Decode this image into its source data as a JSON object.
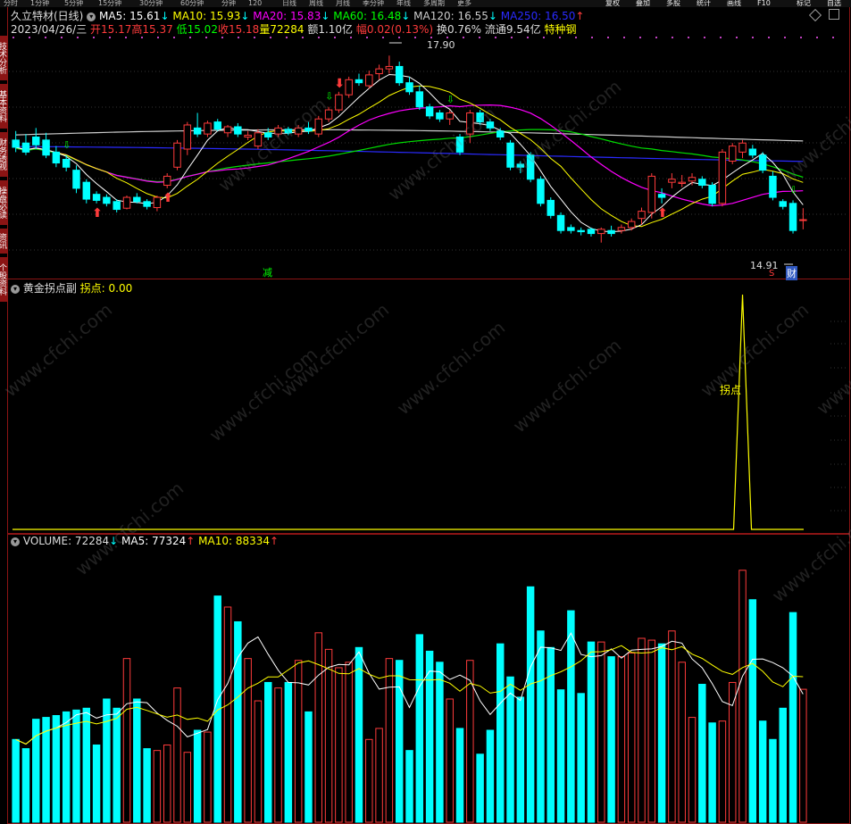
{
  "top_tabs": [
    "分时",
    "1分钟",
    "5分钟",
    "15分钟",
    "30分钟",
    "60分钟",
    "分钟",
    "120",
    "日线",
    "周线",
    "月线",
    "季分钟",
    "年线",
    "多周期",
    "更多"
  ],
  "top_buttons": [
    "复权",
    "叠加",
    "多股",
    "统计",
    "画线",
    "F10",
    "标记",
    "自选"
  ],
  "side_tabs": [
    "技术分析",
    "基本资料",
    "财务透视",
    "操盘必读",
    "资讯",
    "个股资料"
  ],
  "colors": {
    "up": "#ff3b3b",
    "down": "#00ffff",
    "ma5": "#ffffff",
    "ma10": "#ffff00",
    "ma20": "#ff00ff",
    "ma60": "#00ff00",
    "ma120": "#cccccc",
    "ma250": "#0000ff",
    "border": "#8b1414"
  },
  "header": {
    "title": "久立特材(日线)",
    "ma5_label": "MA5: 15.61",
    "ma10_label": "MA10: 15.93",
    "ma20_label": "MA20: 15.83",
    "ma60_label": "MA60: 16.48",
    "ma120_label": "MA120: 16.55",
    "ma250_label": "MA250: 16.50",
    "date": "2023/04/26/三",
    "open": "开15.17",
    "high": "高15.37",
    "low": "低15.02",
    "close": "收15.18",
    "vol": "量72284",
    "amount": "额1.10亿",
    "change": "幅0.02(0.13%)",
    "turnover": "换0.76%",
    "float": "流通9.54亿",
    "sector": "特种钢"
  },
  "price_annotations": {
    "high": "17.90",
    "low": "14.91",
    "reduce": "减",
    "s_mark": "S",
    "cai_mark": "财"
  },
  "indicator": {
    "name": "黄金拐点副",
    "value_label": "拐点: 0.00",
    "peak_label": "拐点"
  },
  "volume": {
    "name_label": "VOLUME: 72284",
    "ma5_label": "MA5: 77324",
    "ma10_label": "MA10: 88334"
  },
  "watermark": "www.cfchi.com",
  "chart_data": {
    "type": "candlestick",
    "price_ylim": [
      14.5,
      18.2
    ],
    "candles": [
      {
        "o": 16.5,
        "h": 16.65,
        "l": 16.3,
        "c": 16.38
      },
      {
        "o": 16.45,
        "h": 16.6,
        "l": 16.25,
        "c": 16.3
      },
      {
        "o": 16.55,
        "h": 16.7,
        "l": 16.35,
        "c": 16.42
      },
      {
        "o": 16.5,
        "h": 16.62,
        "l": 16.2,
        "c": 16.25
      },
      {
        "o": 16.3,
        "h": 16.4,
        "l": 16.05,
        "c": 16.12
      },
      {
        "o": 16.18,
        "h": 16.25,
        "l": 15.98,
        "c": 16.05
      },
      {
        "o": 16.0,
        "h": 16.08,
        "l": 15.62,
        "c": 15.7
      },
      {
        "o": 15.8,
        "h": 15.85,
        "l": 15.45,
        "c": 15.52
      },
      {
        "o": 15.6,
        "h": 15.65,
        "l": 15.45,
        "c": 15.5
      },
      {
        "o": 15.55,
        "h": 15.6,
        "l": 15.4,
        "c": 15.45
      },
      {
        "o": 15.48,
        "h": 15.52,
        "l": 15.3,
        "c": 15.35
      },
      {
        "o": 15.37,
        "h": 15.58,
        "l": 15.35,
        "c": 15.55
      },
      {
        "o": 15.55,
        "h": 15.62,
        "l": 15.45,
        "c": 15.48
      },
      {
        "o": 15.48,
        "h": 15.52,
        "l": 15.35,
        "c": 15.4
      },
      {
        "o": 15.38,
        "h": 15.58,
        "l": 15.32,
        "c": 15.55
      },
      {
        "o": 15.75,
        "h": 15.95,
        "l": 15.7,
        "c": 15.9
      },
      {
        "o": 16.05,
        "h": 16.5,
        "l": 16.0,
        "c": 16.45
      },
      {
        "o": 16.35,
        "h": 16.8,
        "l": 16.25,
        "c": 16.75
      },
      {
        "o": 16.7,
        "h": 16.95,
        "l": 16.55,
        "c": 16.6
      },
      {
        "o": 16.6,
        "h": 16.82,
        "l": 16.55,
        "c": 16.78
      },
      {
        "o": 16.8,
        "h": 16.85,
        "l": 16.65,
        "c": 16.68
      },
      {
        "o": 16.62,
        "h": 16.75,
        "l": 16.55,
        "c": 16.72
      },
      {
        "o": 16.72,
        "h": 16.78,
        "l": 16.55,
        "c": 16.6
      },
      {
        "o": 16.55,
        "h": 16.65,
        "l": 16.5,
        "c": 16.58
      },
      {
        "o": 16.4,
        "h": 16.68,
        "l": 16.35,
        "c": 16.62
      },
      {
        "o": 16.62,
        "h": 16.7,
        "l": 16.5,
        "c": 16.55
      },
      {
        "o": 16.6,
        "h": 16.75,
        "l": 16.55,
        "c": 16.7
      },
      {
        "o": 16.68,
        "h": 16.72,
        "l": 16.58,
        "c": 16.62
      },
      {
        "o": 16.6,
        "h": 16.75,
        "l": 16.55,
        "c": 16.7
      },
      {
        "o": 16.7,
        "h": 16.8,
        "l": 16.6,
        "c": 16.65
      },
      {
        "o": 16.6,
        "h": 16.9,
        "l": 16.55,
        "c": 16.85
      },
      {
        "o": 16.85,
        "h": 17.05,
        "l": 16.8,
        "c": 17.0
      },
      {
        "o": 17.0,
        "h": 17.3,
        "l": 16.95,
        "c": 17.25
      },
      {
        "o": 17.25,
        "h": 17.55,
        "l": 17.2,
        "c": 17.5
      },
      {
        "o": 17.5,
        "h": 17.6,
        "l": 17.4,
        "c": 17.45
      },
      {
        "o": 17.4,
        "h": 17.65,
        "l": 17.35,
        "c": 17.58
      },
      {
        "o": 17.6,
        "h": 17.75,
        "l": 17.5,
        "c": 17.68
      },
      {
        "o": 17.68,
        "h": 17.9,
        "l": 17.6,
        "c": 17.72
      },
      {
        "o": 17.72,
        "h": 17.8,
        "l": 17.4,
        "c": 17.45
      },
      {
        "o": 17.45,
        "h": 17.55,
        "l": 17.25,
        "c": 17.3
      },
      {
        "o": 17.3,
        "h": 17.4,
        "l": 17.0,
        "c": 17.05
      },
      {
        "o": 17.05,
        "h": 17.1,
        "l": 16.85,
        "c": 16.9
      },
      {
        "o": 16.95,
        "h": 17.0,
        "l": 16.8,
        "c": 16.85
      },
      {
        "o": 16.85,
        "h": 17.0,
        "l": 16.75,
        "c": 16.95
      },
      {
        "o": 16.55,
        "h": 16.6,
        "l": 16.25,
        "c": 16.3
      },
      {
        "o": 16.6,
        "h": 17.0,
        "l": 16.45,
        "c": 16.95
      },
      {
        "o": 16.95,
        "h": 17.0,
        "l": 16.75,
        "c": 16.8
      },
      {
        "o": 16.8,
        "h": 16.85,
        "l": 16.65,
        "c": 16.7
      },
      {
        "o": 16.65,
        "h": 16.7,
        "l": 16.5,
        "c": 16.55
      },
      {
        "o": 16.45,
        "h": 16.5,
        "l": 16.0,
        "c": 16.05
      },
      {
        "o": 16.1,
        "h": 16.15,
        "l": 15.95,
        "c": 16.05
      },
      {
        "o": 16.25,
        "h": 16.3,
        "l": 15.8,
        "c": 15.85
      },
      {
        "o": 15.85,
        "h": 15.9,
        "l": 15.4,
        "c": 15.45
      },
      {
        "o": 15.5,
        "h": 15.55,
        "l": 15.2,
        "c": 15.25
      },
      {
        "o": 15.25,
        "h": 15.3,
        "l": 14.95,
        "c": 15.0
      },
      {
        "o": 15.05,
        "h": 15.1,
        "l": 14.95,
        "c": 15.0
      },
      {
        "o": 15.0,
        "h": 15.05,
        "l": 14.92,
        "c": 14.98
      },
      {
        "o": 15.02,
        "h": 15.05,
        "l": 14.9,
        "c": 14.95
      },
      {
        "o": 14.95,
        "h": 15.05,
        "l": 14.8,
        "c": 15.02
      },
      {
        "o": 15.0,
        "h": 15.08,
        "l": 14.9,
        "c": 14.95
      },
      {
        "o": 15.0,
        "h": 15.1,
        "l": 14.95,
        "c": 15.05
      },
      {
        "o": 15.05,
        "h": 15.2,
        "l": 15.0,
        "c": 15.15
      },
      {
        "o": 15.2,
        "h": 15.38,
        "l": 15.1,
        "c": 15.32
      },
      {
        "o": 15.3,
        "h": 15.95,
        "l": 15.2,
        "c": 15.9
      },
      {
        "o": 15.6,
        "h": 15.7,
        "l": 15.45,
        "c": 15.55
      },
      {
        "o": 15.8,
        "h": 15.95,
        "l": 15.7,
        "c": 15.85
      },
      {
        "o": 15.78,
        "h": 15.92,
        "l": 15.72,
        "c": 15.8
      },
      {
        "o": 15.82,
        "h": 15.95,
        "l": 15.75,
        "c": 15.88
      },
      {
        "o": 15.85,
        "h": 15.9,
        "l": 15.7,
        "c": 15.75
      },
      {
        "o": 15.75,
        "h": 15.8,
        "l": 15.4,
        "c": 15.45
      },
      {
        "o": 15.45,
        "h": 16.35,
        "l": 15.4,
        "c": 16.3
      },
      {
        "o": 16.15,
        "h": 16.45,
        "l": 16.1,
        "c": 16.4
      },
      {
        "o": 16.3,
        "h": 16.5,
        "l": 16.2,
        "c": 16.45
      },
      {
        "o": 16.35,
        "h": 16.42,
        "l": 16.2,
        "c": 16.25
      },
      {
        "o": 16.25,
        "h": 16.3,
        "l": 15.95,
        "c": 16.0
      },
      {
        "o": 15.9,
        "h": 15.98,
        "l": 15.5,
        "c": 15.55
      },
      {
        "o": 15.48,
        "h": 15.52,
        "l": 15.35,
        "c": 15.4
      },
      {
        "o": 15.45,
        "h": 15.5,
        "l": 14.95,
        "c": 15.0
      },
      {
        "o": 15.17,
        "h": 15.37,
        "l": 15.02,
        "c": 15.18
      }
    ],
    "volume_ylim": [
      0,
      150000
    ],
    "volumes": [
      45000,
      40000,
      56000,
      57000,
      58000,
      60000,
      61000,
      62000,
      42000,
      67000,
      62000,
      89000,
      67000,
      40000,
      39000,
      42000,
      73000,
      38000,
      50000,
      49000,
      123000,
      117000,
      109000,
      89000,
      66000,
      76000,
      73000,
      76000,
      88000,
      60000,
      103000,
      94000,
      84000,
      87000,
      95000,
      45000,
      51000,
      89000,
      88000,
      39000,
      102000,
      93000,
      87000,
      67000,
      51000,
      88000,
      37000,
      50000,
      97000,
      79000,
      68000,
      128000,
      104000,
      95000,
      72000,
      115000,
      70000,
      98000,
      98000,
      90000,
      90000,
      92000,
      100000,
      99000,
      97000,
      104000,
      87000,
      57000,
      75000,
      54000,
      55000,
      76000,
      137000,
      121000,
      55000,
      45000,
      62000,
      114000,
      72284
    ],
    "indicator_values_note": "0 everywhere except peak near candle 72",
    "indicator_peak_index": 72,
    "indicator_peak_value": 1.0
  }
}
